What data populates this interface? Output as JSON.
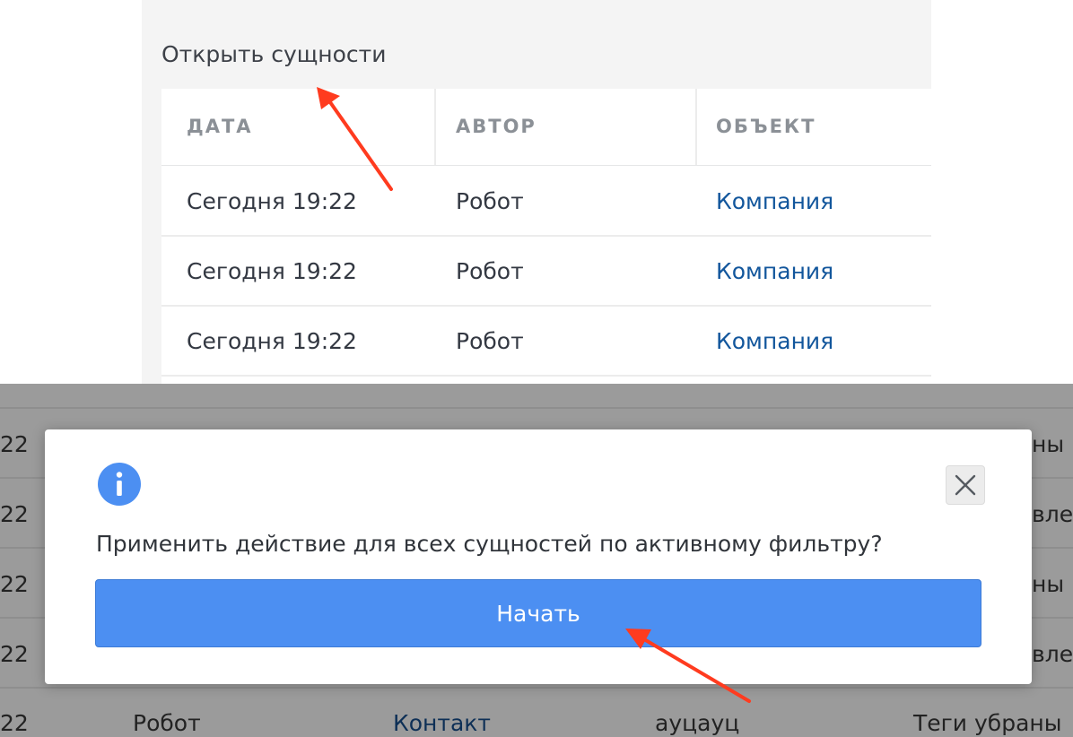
{
  "top": {
    "title": "Открыть сущности",
    "columns": [
      "ДАТА",
      "АВТОР",
      "ОБЪЕКТ"
    ],
    "rows": [
      {
        "date": "Сегодня 19:22",
        "author": "Робот",
        "object": "Компания"
      },
      {
        "date": "Сегодня 19:22",
        "author": "Робот",
        "object": "Компания"
      },
      {
        "date": "Сегодня 19:22",
        "author": "Робот",
        "object": "Компания"
      }
    ]
  },
  "background": {
    "left_fragments": [
      "22",
      "22",
      "22",
      "22",
      "22"
    ],
    "right_fragments": [
      "ны",
      "влек",
      "ны",
      "влек"
    ],
    "bottom_row": {
      "date_fragment": "22",
      "author": "Робот",
      "object": "Контакт",
      "title": "ауцауц",
      "event": "Теги убраны"
    }
  },
  "modal": {
    "question": "Применить действие для всех сущностей по активному фильтру?",
    "start_label": "Начать",
    "info_icon": "info-icon",
    "close_icon": "close-icon"
  },
  "colors": {
    "accent": "#4c8ff2",
    "link": "#12569c",
    "arrow": "#ff3b1f",
    "overlay": "#9b9b9b"
  }
}
